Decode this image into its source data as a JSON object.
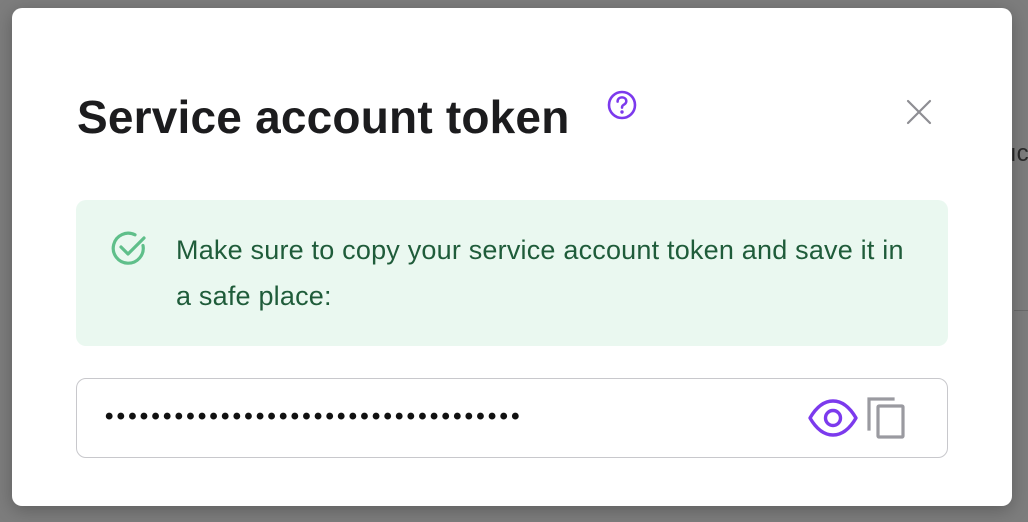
{
  "background": {
    "partial_text": "ıc"
  },
  "dialog": {
    "title": "Service account token",
    "help_icon": "question-circle-icon",
    "close_icon": "close-icon",
    "notice": {
      "icon": "check-circle-icon",
      "message": "Make sure to copy your service account token and save it in a safe place:"
    },
    "token": {
      "masked_value": "••••••••••••••••••••••••••••••••••••",
      "reveal_icon": "eye-icon",
      "copy_icon": "copy-icon"
    }
  },
  "colors": {
    "accent": "#7c3aed",
    "notice_bg": "#eaf8f0",
    "notice_text": "#1f5c3a",
    "success_icon": "#5fbf8a",
    "muted_icon": "#8e8e93"
  }
}
